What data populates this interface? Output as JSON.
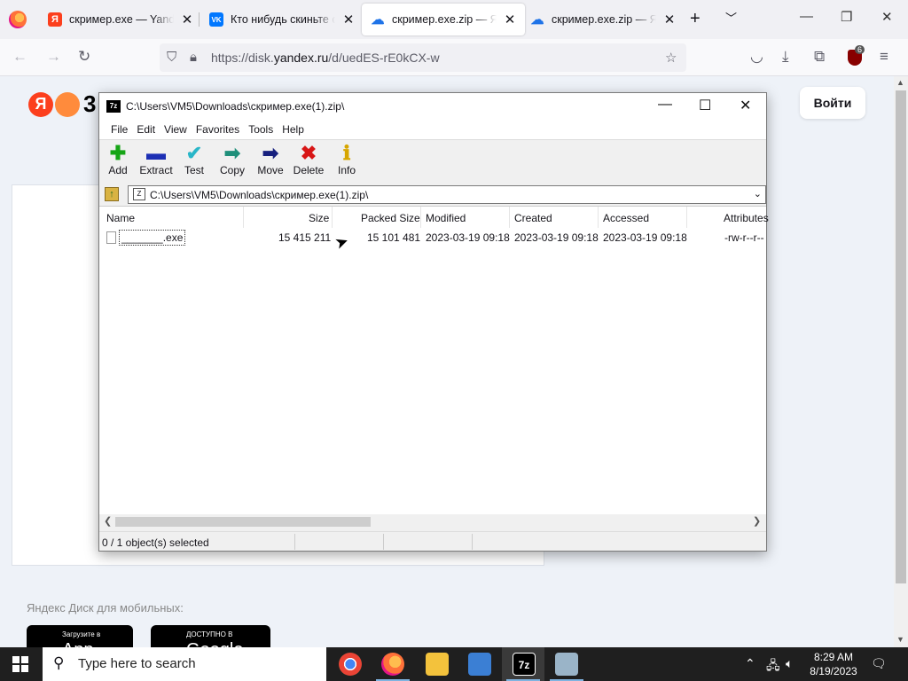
{
  "browser": {
    "tabs": [
      {
        "title": "скример.exe — Yandex",
        "favicon": "Я",
        "color": "#fc3f1d",
        "active": false
      },
      {
        "title": "Кто нибудь скиньте скример",
        "favicon": "VK",
        "color": "#0077ff",
        "active": false
      },
      {
        "title": "скример.exe.zip — Яндекс",
        "favicon": "disk",
        "color": "#1e73e8",
        "active": true
      },
      {
        "title": "скример.exe.zip — Яндекс",
        "favicon": "disk",
        "color": "#1e73e8",
        "active": false
      }
    ],
    "url_prefix": "https://disk.",
    "url_domain": "yandex.ru",
    "url_path": "/d/uedES-rE0kCX-w",
    "extension_badge": "6"
  },
  "page": {
    "logo_letter": "Я",
    "logo_suffix": "3",
    "login_label": "Войти",
    "mobile_label": "Яндекс Диск для мобильных:",
    "app_store_small": "Загрузите в",
    "app_store_big": "App Store",
    "google_play_small": "ДОСТУПНО В",
    "google_play_big": "Google Play"
  },
  "sevenzip": {
    "icon_text": "7z",
    "title": "C:\\Users\\VM5\\Downloads\\скример.exe(1).zip\\",
    "menu": [
      "File",
      "Edit",
      "View",
      "Favorites",
      "Tools",
      "Help"
    ],
    "toolbar": [
      {
        "label": "Add",
        "icon": "plus-icon",
        "color": "#16a516",
        "glyph": "✚"
      },
      {
        "label": "Extract",
        "icon": "minus-icon",
        "color": "#1c2fb4",
        "glyph": "▬"
      },
      {
        "label": "Test",
        "icon": "check-icon",
        "color": "#29b6c8",
        "glyph": "✔"
      },
      {
        "label": "Copy",
        "icon": "arrow-right-icon",
        "color": "#1f8f7a",
        "glyph": "➡"
      },
      {
        "label": "Move",
        "icon": "arrow-right-icon",
        "color": "#17207e",
        "glyph": "➡"
      },
      {
        "label": "Delete",
        "icon": "x-icon",
        "color": "#d81616",
        "glyph": "✖"
      },
      {
        "label": "Info",
        "icon": "info-icon",
        "color": "#d7a600",
        "glyph": "ℹ"
      }
    ],
    "address": "C:\\Users\\VM5\\Downloads\\скример.exe(1).zip\\",
    "columns": [
      "Name",
      "Size",
      "Packed Size",
      "Modified",
      "Created",
      "Accessed",
      "Attributes"
    ],
    "rows": [
      {
        "name": "_______.exe",
        "size": "15 415 211",
        "packed": "15 101 481",
        "modified": "2023-03-19 09:18",
        "created": "2023-03-19 09:18",
        "accessed": "2023-03-19 09:18",
        "attributes": "-rw-r--r--"
      }
    ],
    "status": "0 / 1 object(s) selected"
  },
  "taskbar": {
    "search_placeholder": "Type here to search",
    "time": "8:29 AM",
    "date": "8/19/2023"
  }
}
